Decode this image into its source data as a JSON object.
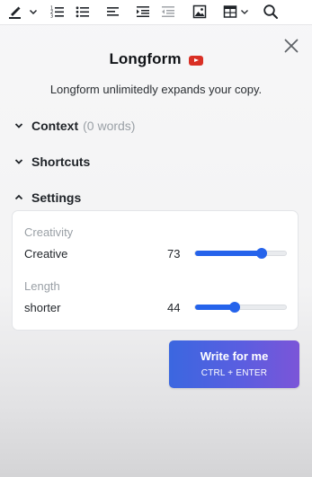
{
  "toolbar": {
    "icons": [
      "highlight-pen-icon",
      "chevron-down-icon",
      "numbered-list-icon",
      "bullet-list-icon",
      "align-left-icon",
      "indent-icon",
      "outdent-icon",
      "image-icon",
      "table-icon",
      "chevron-down-icon",
      "search-icon"
    ]
  },
  "panel": {
    "title": "Longform",
    "subtitle": "Longform unlimitedly expands your copy.",
    "sections": {
      "context": {
        "label": "Context",
        "meta": "(0 words)",
        "expanded": false
      },
      "shortcuts": {
        "label": "Shortcuts",
        "expanded": false
      },
      "settings": {
        "label": "Settings",
        "expanded": true
      }
    },
    "settings": {
      "creativity": {
        "group_label": "Creativity",
        "value_label": "Creative",
        "value": "73",
        "level_percent": 73
      },
      "length": {
        "group_label": "Length",
        "value_label": "shorter",
        "value": "44",
        "level_percent": 44
      }
    },
    "write_button": {
      "label": "Write for me",
      "shortcut": "CTRL + ENTER"
    }
  },
  "colors": {
    "accent_blue": "#2563eb",
    "button_gradient_start": "#3b67e0",
    "button_gradient_end": "#7b55d8",
    "youtube_red": "#d93025"
  }
}
